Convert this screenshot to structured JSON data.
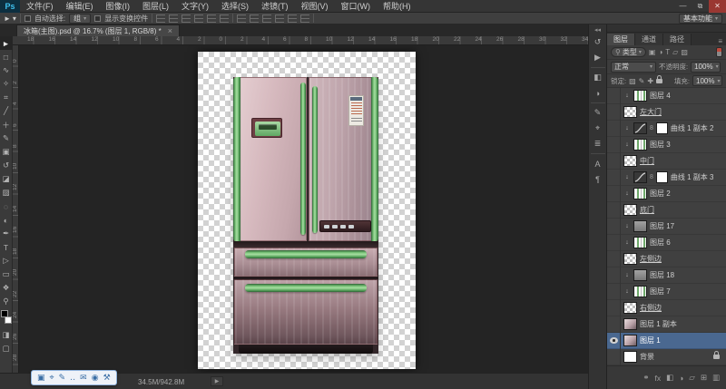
{
  "window": {
    "logo": "Ps",
    "controls": [
      {
        "name": "minimize-button",
        "glyph": "—"
      },
      {
        "name": "restore-button",
        "glyph": "⧉"
      },
      {
        "name": "close-button",
        "glyph": "✕"
      }
    ]
  },
  "menu": {
    "items": [
      "文件(F)",
      "编辑(E)",
      "图像(I)",
      "图层(L)",
      "文字(Y)",
      "选择(S)",
      "滤镜(T)",
      "视图(V)",
      "窗口(W)",
      "帮助(H)"
    ]
  },
  "options": {
    "auto_select_label": "自动选择:",
    "auto_select_value": "组",
    "show_transform_label": "显示变换控件",
    "workspace": "基本功能"
  },
  "doc_tab": {
    "title": "冰箱(主图).psd @ 16.7% (图层 1, RGB/8) *",
    "close": "×"
  },
  "rulers": {
    "horizontal": [
      "18",
      "16",
      "14",
      "12",
      "10",
      "8",
      "6",
      "4",
      "2",
      "0",
      "2",
      "4",
      "6",
      "8",
      "10",
      "12",
      "14",
      "16",
      "18",
      "20",
      "22",
      "24",
      "26",
      "28",
      "30",
      "32",
      "34"
    ],
    "vertical": [
      "0",
      "2",
      "4",
      "6",
      "8",
      "10",
      "12",
      "14",
      "16",
      "18",
      "20",
      "22",
      "24",
      "26",
      "28"
    ]
  },
  "tools": [
    {
      "name": "move-tool",
      "glyph": "►",
      "selected": true
    },
    {
      "name": "marquee-tool",
      "glyph": "□"
    },
    {
      "name": "lasso-tool",
      "glyph": "∿"
    },
    {
      "name": "quick-selection-tool",
      "glyph": "✧"
    },
    {
      "name": "crop-tool",
      "glyph": "⌗"
    },
    {
      "name": "eyedropper-tool",
      "glyph": "╱"
    },
    {
      "name": "healing-brush-tool",
      "glyph": "＋"
    },
    {
      "name": "brush-tool",
      "glyph": "✎"
    },
    {
      "name": "clone-stamp-tool",
      "glyph": "▣"
    },
    {
      "name": "history-brush-tool",
      "glyph": "↺"
    },
    {
      "name": "eraser-tool",
      "glyph": "◪"
    },
    {
      "name": "gradient-tool",
      "glyph": "▨"
    },
    {
      "name": "blur-tool",
      "glyph": "◌"
    },
    {
      "name": "dodge-tool",
      "glyph": "◐"
    },
    {
      "name": "pen-tool",
      "glyph": "✒"
    },
    {
      "name": "type-tool",
      "glyph": "T"
    },
    {
      "name": "path-selection-tool",
      "glyph": "▷"
    },
    {
      "name": "shape-tool",
      "glyph": "▭"
    },
    {
      "name": "hand-tool",
      "glyph": "❖"
    },
    {
      "name": "zoom-tool",
      "glyph": "⚲"
    },
    {
      "name": "quick-mask-button",
      "glyph": "◨"
    },
    {
      "name": "screen-mode-button",
      "glyph": "▢"
    }
  ],
  "dock": [
    {
      "name": "history-panel-icon",
      "glyph": "↺"
    },
    {
      "name": "actions-panel-icon",
      "glyph": "▶"
    },
    {
      "sep": true
    },
    {
      "name": "color-panel-icon",
      "glyph": "◧"
    },
    {
      "name": "adjustments-panel-icon",
      "glyph": "◑"
    },
    {
      "sep": true
    },
    {
      "name": "brush-panel-icon",
      "glyph": "✎"
    },
    {
      "name": "clone-source-panel-icon",
      "glyph": "⌖"
    },
    {
      "name": "info-panel-icon",
      "glyph": "≣"
    },
    {
      "sep": true
    },
    {
      "name": "character-panel-icon",
      "glyph": "A"
    },
    {
      "name": "paragraph-panel-icon",
      "glyph": "¶"
    }
  ],
  "layers_panel": {
    "tabs": [
      {
        "label": "图层",
        "active": true
      },
      {
        "label": "通道",
        "active": false
      },
      {
        "label": "路径",
        "active": false
      }
    ],
    "filter_label": "类型",
    "filter_icons": [
      {
        "name": "pixel-filter-icon",
        "glyph": "▣"
      },
      {
        "name": "adjustment-filter-icon",
        "glyph": "◑"
      },
      {
        "name": "type-filter-icon",
        "glyph": "T"
      },
      {
        "name": "shape-filter-icon",
        "glyph": "▱"
      },
      {
        "name": "smart-object-filter-icon",
        "glyph": "▨"
      }
    ],
    "blend_mode": "正常",
    "opacity_label": "不透明度:",
    "opacity_value": "100%",
    "lock_label": "锁定:",
    "lock_icons": [
      {
        "name": "lock-transparent-icon",
        "glyph": "▨"
      },
      {
        "name": "lock-paint-icon",
        "glyph": "✎"
      },
      {
        "name": "lock-move-icon",
        "glyph": "✚"
      },
      {
        "name": "lock-all-icon",
        "glyph": ""
      }
    ],
    "fill_label": "填充:",
    "fill_value": "100%",
    "layers": [
      {
        "name": "图层 4",
        "kind": "stripes",
        "clipped": true
      },
      {
        "name": "左大门",
        "kind": "checker",
        "underline": true
      },
      {
        "name": "曲线 1 副本 2",
        "kind": "adjust",
        "clipped": true
      },
      {
        "name": "图层 3",
        "kind": "stripes",
        "clipped": true
      },
      {
        "name": "中门",
        "kind": "checker",
        "underline": true
      },
      {
        "name": "曲线 1 副本 3",
        "kind": "adjust",
        "clipped": true
      },
      {
        "name": "图层 2",
        "kind": "stripes",
        "clipped": true
      },
      {
        "name": "底门",
        "kind": "checker",
        "underline": true
      },
      {
        "name": "图层 17",
        "kind": "plain",
        "clipped": true
      },
      {
        "name": "图层 6",
        "kind": "stripes",
        "clipped": true
      },
      {
        "name": "左侧边",
        "kind": "checker",
        "underline": true
      },
      {
        "name": "图层 18",
        "kind": "plain",
        "clipped": true
      },
      {
        "name": "图层 7",
        "kind": "stripes",
        "clipped": true
      },
      {
        "name": "右侧边",
        "kind": "checker",
        "underline": true
      },
      {
        "name": "图层 1 副本",
        "kind": "image"
      },
      {
        "name": "图层 1",
        "kind": "image",
        "selected": true,
        "visible": true
      },
      {
        "name": "背景",
        "kind": "bg",
        "locked": true
      }
    ],
    "footer_icons": [
      {
        "name": "link-layers-icon",
        "glyph": "⚭"
      },
      {
        "name": "layer-style-icon",
        "glyph": "fx"
      },
      {
        "name": "add-mask-icon",
        "glyph": "◧"
      },
      {
        "name": "new-adjustment-icon",
        "glyph": "◑"
      },
      {
        "name": "new-group-icon",
        "glyph": "▱"
      },
      {
        "name": "new-layer-icon",
        "glyph": "⊞"
      },
      {
        "name": "delete-layer-icon",
        "glyph": "▥"
      }
    ]
  },
  "status": {
    "doc_size": "34.5M/942.8M"
  },
  "overlay_toolbar": {
    "icons": [
      {
        "name": "shape-icon",
        "glyph": "▣"
      },
      {
        "name": "ellipse-icon",
        "glyph": "⌖"
      },
      {
        "name": "pen-icon",
        "glyph": "✎"
      },
      {
        "name": "more-icon",
        "glyph": "‥"
      },
      {
        "name": "message-icon",
        "glyph": "✉"
      },
      {
        "name": "person-icon",
        "glyph": "◉"
      },
      {
        "name": "tools-icon",
        "glyph": "⚒"
      }
    ]
  },
  "colors": {
    "accent_green": "#5aa85e",
    "selection_blue": "#4a6890",
    "fridge_pink": "#cdb3b8",
    "close_red": "#9a3732"
  }
}
